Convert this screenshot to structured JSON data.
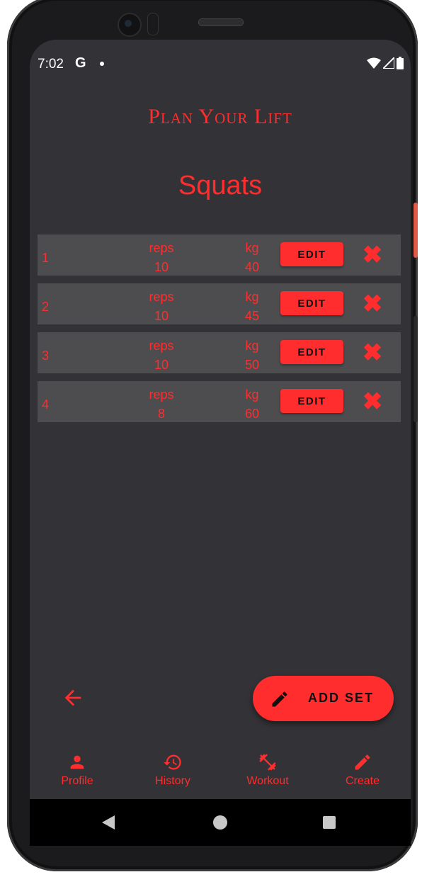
{
  "status_bar": {
    "time": "7:02",
    "google_badge": "G"
  },
  "app": {
    "title": "Plan Your Lift",
    "exercise": "Squats"
  },
  "sets": [
    {
      "number": "1",
      "reps_label": "reps",
      "reps": "10",
      "kg_label": "kg",
      "kg": "40",
      "edit_label": "EDIT"
    },
    {
      "number": "2",
      "reps_label": "reps",
      "reps": "10",
      "kg_label": "kg",
      "kg": "45",
      "edit_label": "EDIT"
    },
    {
      "number": "3",
      "reps_label": "reps",
      "reps": "10",
      "kg_label": "kg",
      "kg": "50",
      "edit_label": "EDIT"
    },
    {
      "number": "4",
      "reps_label": "reps",
      "reps": "8",
      "kg_label": "kg",
      "kg": "60",
      "edit_label": "EDIT"
    }
  ],
  "fab": {
    "label": "ADD SET",
    "icon": "pencil-icon"
  },
  "bottom_nav": [
    {
      "label": "Profile",
      "icon": "person-icon"
    },
    {
      "label": "History",
      "icon": "history-icon"
    },
    {
      "label": "Workout",
      "icon": "dumbbell-icon"
    },
    {
      "label": "Create",
      "icon": "pencil-icon"
    }
  ],
  "colors": {
    "accent": "#ff2d2d",
    "background": "#333236",
    "row": "#4d4d4f"
  }
}
